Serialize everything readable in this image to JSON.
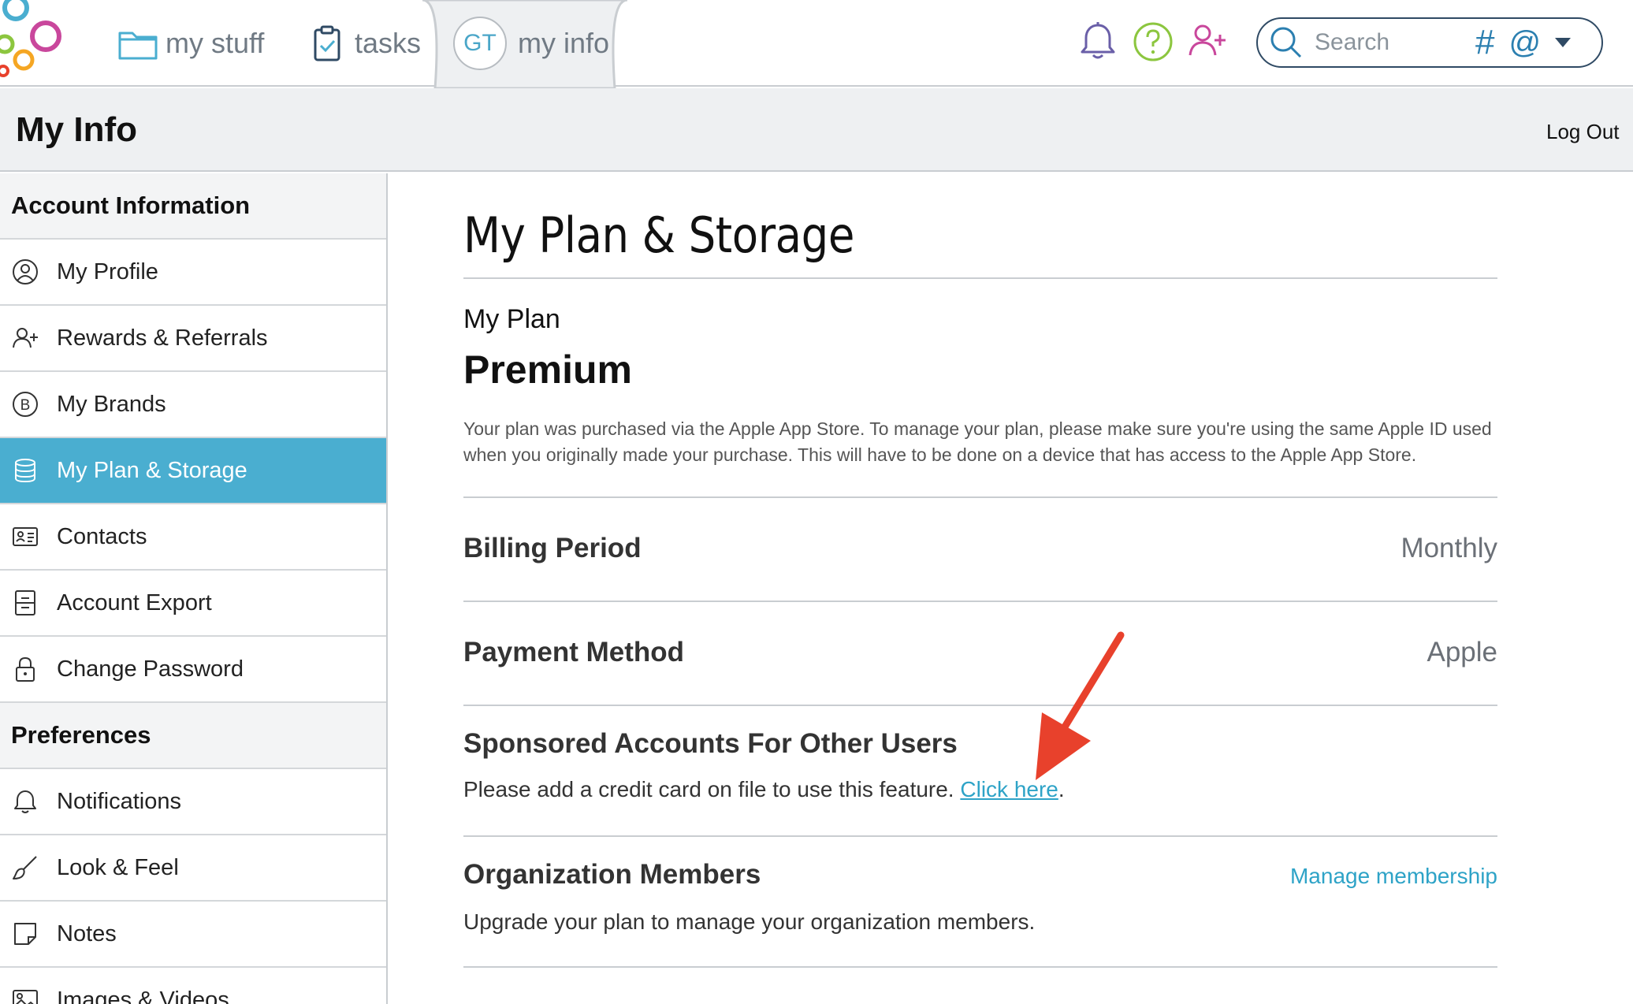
{
  "topnav": {
    "my_stuff": "my stuff",
    "tasks": "tasks",
    "my_info": "my info",
    "avatar_initials": "GT",
    "search_placeholder": "Search",
    "hash_symbol": "#",
    "at_symbol": "@",
    "icons": [
      "bell-icon",
      "help-icon",
      "add-user-icon",
      "search-icon",
      "folder-icon",
      "clipboard-icon"
    ]
  },
  "header": {
    "title": "My Info",
    "logout": "Log Out"
  },
  "sidebar": {
    "sections": [
      {
        "title": "Account Information",
        "items": [
          {
            "label": "My Profile",
            "icon": "profile-icon"
          },
          {
            "label": "Rewards & Referrals",
            "icon": "add-user-icon"
          },
          {
            "label": "My Brands",
            "icon": "brand-icon"
          },
          {
            "label": "My Plan & Storage",
            "icon": "database-icon",
            "active": true
          },
          {
            "label": "Contacts",
            "icon": "contact-card-icon"
          },
          {
            "label": "Account Export",
            "icon": "export-icon"
          },
          {
            "label": "Change Password",
            "icon": "lock-icon"
          }
        ]
      },
      {
        "title": "Preferences",
        "items": [
          {
            "label": "Notifications",
            "icon": "bell-icon"
          },
          {
            "label": "Look & Feel",
            "icon": "brush-icon"
          },
          {
            "label": "Notes",
            "icon": "note-icon"
          },
          {
            "label": "Images & Videos",
            "icon": "image-icon"
          }
        ]
      }
    ]
  },
  "main": {
    "title": "My Plan & Storage",
    "my_plan_label": "My Plan",
    "plan_name": "Premium",
    "plan_description": "Your plan was purchased via the Apple App Store. To manage your plan, please make sure you're using the same Apple ID used when you originally made your purchase. This will have to be done on a device that has access to the Apple App Store.",
    "billing_period": {
      "label": "Billing Period",
      "value": "Monthly"
    },
    "payment_method": {
      "label": "Payment Method",
      "value": "Apple"
    },
    "sponsored": {
      "title": "Sponsored Accounts For Other Users",
      "text": "Please add a credit card on file to use this feature.",
      "link": "Click here",
      "after": "."
    },
    "organization": {
      "title": "Organization Members",
      "link": "Manage membership",
      "text": "Upgrade your plan to manage your organization members."
    }
  },
  "colors": {
    "accent": "#4aaed0",
    "link": "#2ea3c7",
    "annotation_arrow": "#e8412c"
  }
}
